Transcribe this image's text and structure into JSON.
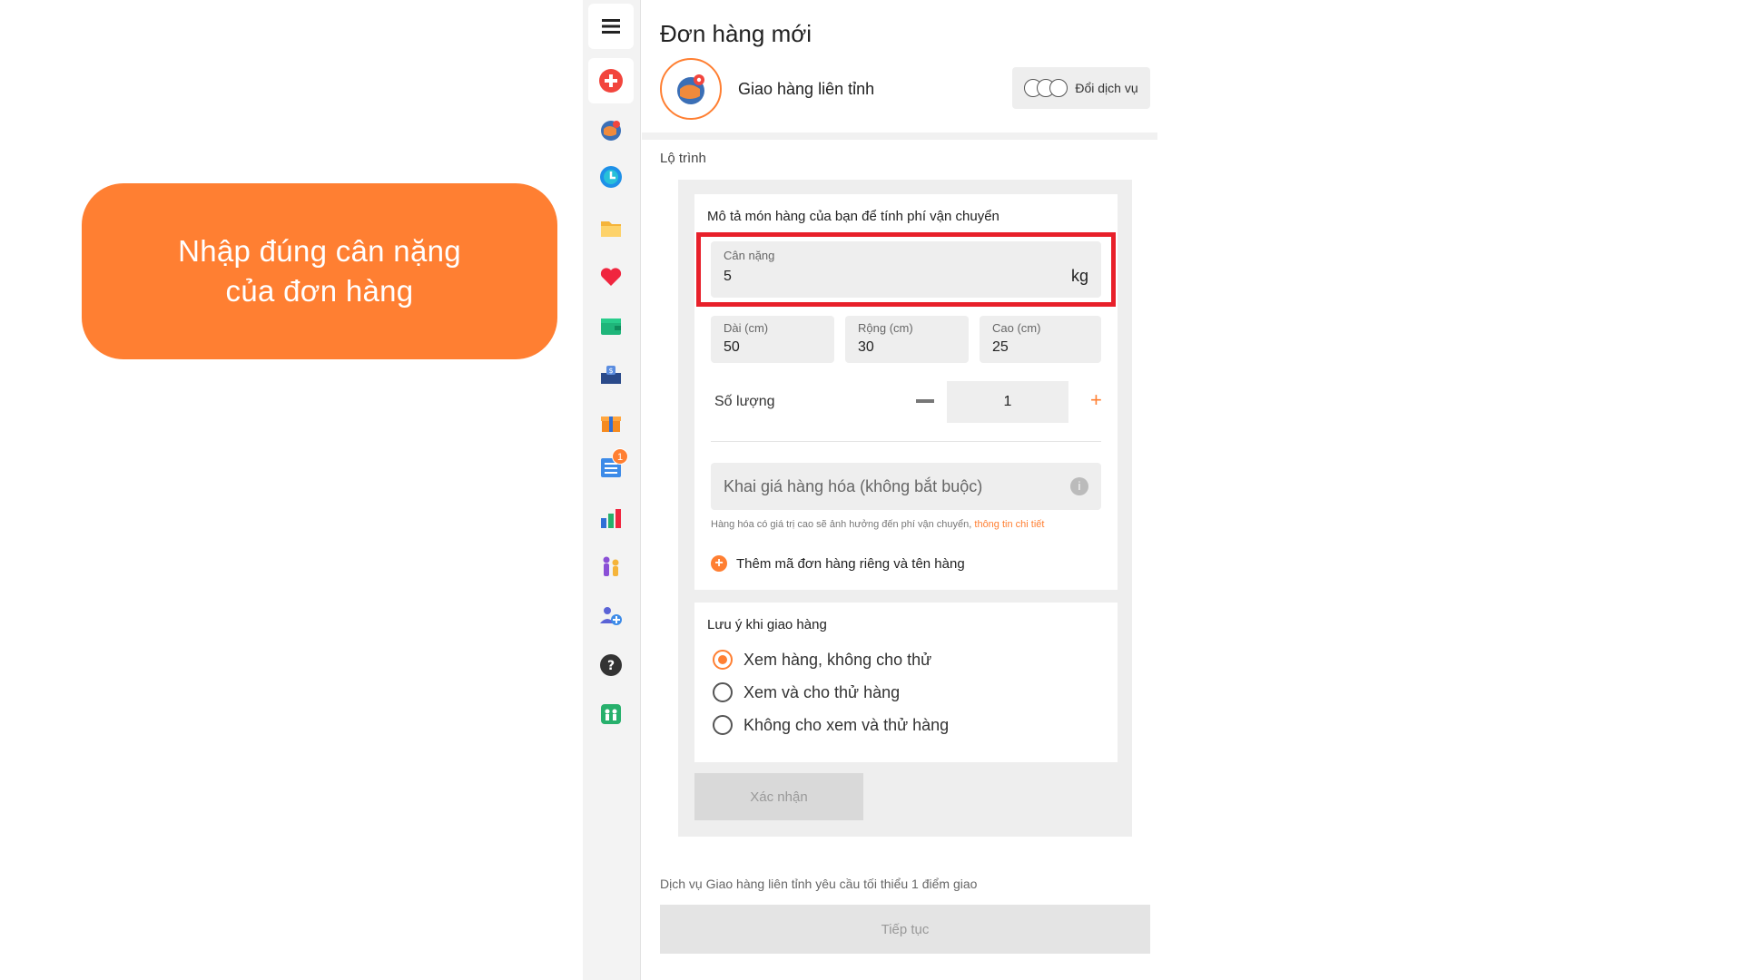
{
  "callout": {
    "text": "Nhập đúng cân nặng\ncủa đơn hàng",
    "color": "#ff7f32"
  },
  "sidebar": {
    "items": [
      {
        "icon": "hamburger-menu-icon"
      },
      {
        "icon": "add-order-icon"
      },
      {
        "icon": "globe-delivery-icon"
      },
      {
        "icon": "clock-icon"
      },
      {
        "icon": "folder-icon"
      },
      {
        "icon": "heart-icon"
      },
      {
        "icon": "wallet-icon"
      },
      {
        "icon": "money-box-icon"
      },
      {
        "icon": "gift-icon"
      },
      {
        "icon": "list-icon",
        "badge": "1"
      },
      {
        "icon": "bar-chart-icon"
      },
      {
        "icon": "people-icon"
      },
      {
        "icon": "add-user-icon"
      },
      {
        "icon": "help-icon"
      },
      {
        "icon": "team-icon"
      }
    ]
  },
  "header": {
    "title": "Đơn hàng mới",
    "service_name": "Giao hàng liên tỉnh",
    "switch_label": "Đổi dịch vụ"
  },
  "route": {
    "label": "Lộ trình"
  },
  "item_card": {
    "title": "Mô tả món hàng của bạn để tính phí vận chuyển",
    "weight": {
      "label": "Cân nặng",
      "value": "5",
      "unit": "kg"
    },
    "length": {
      "label": "Dài (cm)",
      "value": "50"
    },
    "width": {
      "label": "Rộng (cm)",
      "value": "30"
    },
    "height": {
      "label": "Cao (cm)",
      "value": "25"
    },
    "quantity": {
      "label": "Số lượng",
      "value": "1",
      "minus": "—",
      "plus": "+"
    },
    "declare_placeholder": "Khai giá hàng hóa (không bắt buộc)",
    "note_text": "Hàng hóa có giá trị cao sẽ ảnh hưởng đến phí vận chuyển, ",
    "note_link": "thông tin chi tiết",
    "add_extra": "Thêm mã đơn hàng riêng và tên hàng"
  },
  "delivery_note": {
    "title": "Lưu ý khi giao hàng",
    "options": [
      {
        "label": "Xem hàng, không cho thử",
        "selected": true
      },
      {
        "label": "Xem và cho thử hàng",
        "selected": false
      },
      {
        "label": "Không cho xem và thử hàng",
        "selected": false
      }
    ]
  },
  "confirm_label": "Xác nhận",
  "requirement_note": "Dịch vụ Giao hàng liên tỉnh yêu cầu tối thiểu 1 điểm giao",
  "continue_label": "Tiếp tục",
  "colors": {
    "accent": "#ff7f32",
    "highlight": "#e8202a"
  }
}
